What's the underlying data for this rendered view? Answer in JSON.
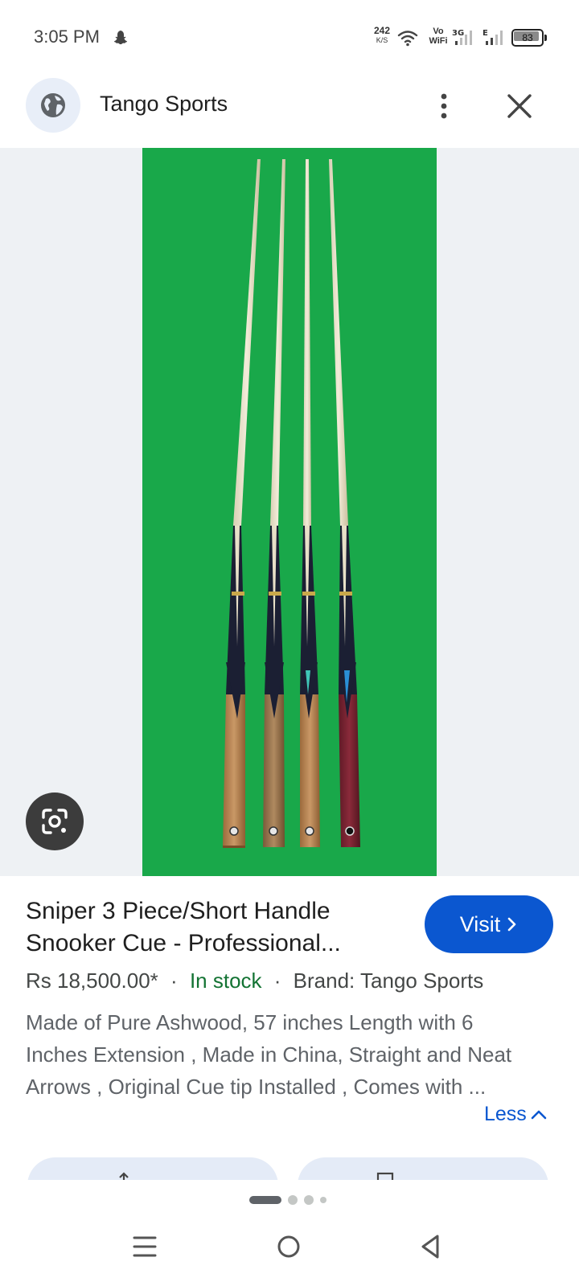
{
  "status_bar": {
    "time": "3:05 PM",
    "net_speed_value": "242",
    "net_speed_unit": "K/S",
    "vowifi_top": "Vo",
    "vowifi_bottom": "WiFi",
    "network_3g": "3G",
    "network_e": "E",
    "battery": "83",
    "icons": [
      "snapchat-ghost-icon",
      "wifi-icon",
      "signal-icon",
      "battery-icon"
    ]
  },
  "header": {
    "site_name": "Tango Sports",
    "icons": [
      "globe-icon",
      "more-vertical-icon",
      "close-icon"
    ]
  },
  "image": {
    "background_color": "#19a84a",
    "lens_icon": "google-lens-icon"
  },
  "product": {
    "title_line1": "Sniper 3 Piece/Short Handle",
    "title_line2": "Snooker Cue - Professional...",
    "price": "Rs 18,500.00*",
    "separator": "·",
    "stock": "In stock",
    "brand": "Brand: Tango Sports",
    "desc_line1": "Made of Pure Ashwood, 57 inches Length with 6",
    "desc_line2": "Inches Extension , Made in China, Straight and Neat",
    "desc_line3": "Arrows , Original Cue tip Installed , Comes with ...",
    "less_label": "Less"
  },
  "visit_button": {
    "label": "Visit",
    "color": "#0b57d0"
  },
  "pager": {
    "total": 4,
    "active": 0
  },
  "nav_bar": {
    "icons": [
      "recents-icon",
      "home-icon",
      "back-icon"
    ]
  }
}
